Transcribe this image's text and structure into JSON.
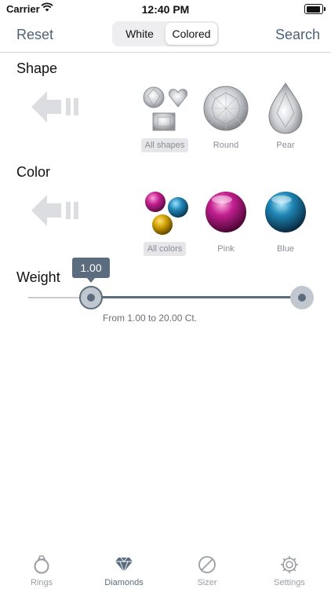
{
  "status_bar": {
    "carrier": "Carrier",
    "time": "12:40 PM"
  },
  "nav": {
    "reset_label": "Reset",
    "search_label": "Search",
    "segments": [
      "White",
      "Colored"
    ],
    "selected_segment": "Colored"
  },
  "shape": {
    "title": "Shape",
    "options": [
      {
        "label": "All shapes",
        "icon": "all-shapes-icon",
        "selected": true
      },
      {
        "label": "Round",
        "icon": "round-diamond-icon",
        "selected": false
      },
      {
        "label": "Pear",
        "icon": "pear-diamond-icon",
        "selected": false
      }
    ]
  },
  "color": {
    "title": "Color",
    "options": [
      {
        "label": "All colors",
        "icon": "all-colors-icon",
        "selected": true
      },
      {
        "label": "Pink",
        "icon": "pink-gem-icon",
        "selected": false
      },
      {
        "label": "Blue",
        "icon": "blue-gem-icon",
        "selected": false
      }
    ],
    "colors": {
      "pink": "#c21f8f",
      "blue": "#1f86b5",
      "yellow": "#d1a000"
    }
  },
  "weight": {
    "title": "Weight",
    "bubble_value": "1.00",
    "range_text": "From 1.00 to 20.00 Ct.",
    "min": 1.0,
    "max": 20.0
  },
  "tabs": [
    {
      "label": "Rings",
      "icon": "ring-icon",
      "active": false
    },
    {
      "label": "Diamonds",
      "icon": "diamond-icon",
      "active": true
    },
    {
      "label": "Sizer",
      "icon": "sizer-icon",
      "active": false
    },
    {
      "label": "Settings",
      "icon": "gear-icon",
      "active": false
    }
  ],
  "accent_color": "#5a6c7d"
}
